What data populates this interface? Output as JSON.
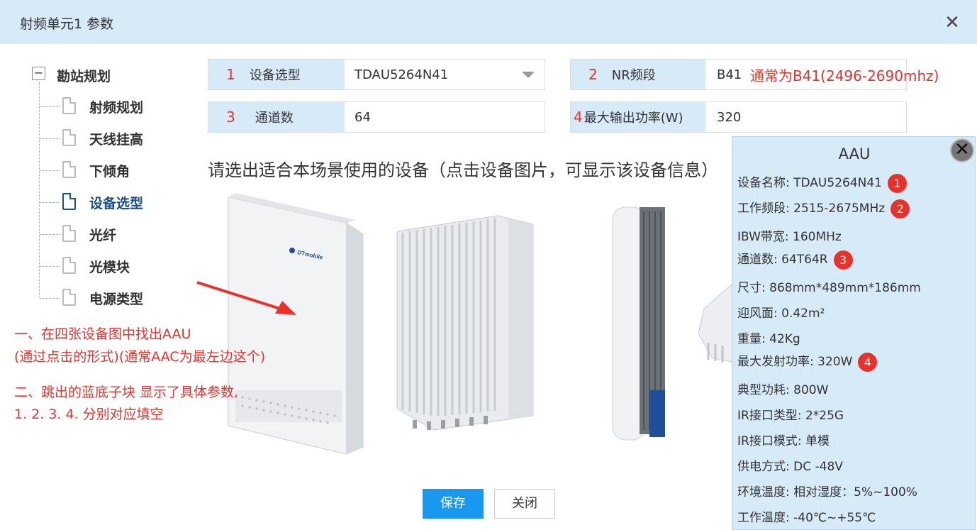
{
  "window": {
    "title": "射频单元1 参数",
    "close_glyph": "✕"
  },
  "tree": {
    "root": {
      "toggle": "−",
      "label": "勘站规划"
    },
    "items": [
      {
        "label": "射频规划"
      },
      {
        "label": "天线挂高"
      },
      {
        "label": "下倾角"
      },
      {
        "label": "设备选型",
        "active": true
      },
      {
        "label": "光纤"
      },
      {
        "label": "光模块"
      },
      {
        "label": "电源类型"
      }
    ]
  },
  "form": {
    "device_type": {
      "num": "1",
      "label": "设备选型",
      "value": "TDAU5264N41"
    },
    "nr_band": {
      "num": "2",
      "label": "NR频段",
      "value": "B41"
    },
    "channels": {
      "num": "3",
      "label": "通道数",
      "value": "64"
    },
    "max_power": {
      "num": "4",
      "label": "最大输出功率(W)",
      "value": "320"
    }
  },
  "notes": {
    "band_hint": "通常为B41(2496-2690mhz)",
    "step1_line1": "一、在四张设备图中找出AAU",
    "step1_line2": "(通过点击的形式)(通常AAC为最左边这个)",
    "step2_line1": "二、跳出的蓝底子块 显示了具体参数,",
    "step2_line2": "1. 2. 3. 4. 分别对应填空"
  },
  "prompt": "请选出适合本场景使用的设备（点击设备图片，可显示该设备信息）",
  "device1_logo": "DTmobile",
  "buttons": {
    "save": "保存",
    "close": "关闭"
  },
  "popup": {
    "title": "AAU",
    "close_glyph": "✕",
    "specs": [
      {
        "text": "设备名称: TDAU5264N41",
        "badge": "1"
      },
      {
        "text": "工作频段: 2515-2675MHz",
        "badge": "2"
      },
      {
        "text": "IBW带宽: 160MHz"
      },
      {
        "text": "通道数: 64T64R",
        "badge": "3"
      },
      {
        "text": "尺寸: 868mm*489mm*186mm"
      },
      {
        "text": "迎风面: 0.42m²"
      },
      {
        "text": "重量: 42Kg"
      },
      {
        "text": "最大发射功率: 320W",
        "badge": "4"
      },
      {
        "text": "典型功耗: 800W"
      },
      {
        "text": "IR接口类型: 2*25G"
      },
      {
        "text": "IR接口模式: 单模"
      },
      {
        "text": "供电方式: DC -48V"
      },
      {
        "text": "环境温度: 相对湿度：5%~100%"
      },
      {
        "text": "工作温度: -40℃~+55℃"
      }
    ]
  },
  "colors": {
    "accent_red": "#e8312a",
    "header_blue": "#d7eaf8",
    "primary_button": "#1a98f0",
    "active_tree": "#1a4f8a"
  }
}
